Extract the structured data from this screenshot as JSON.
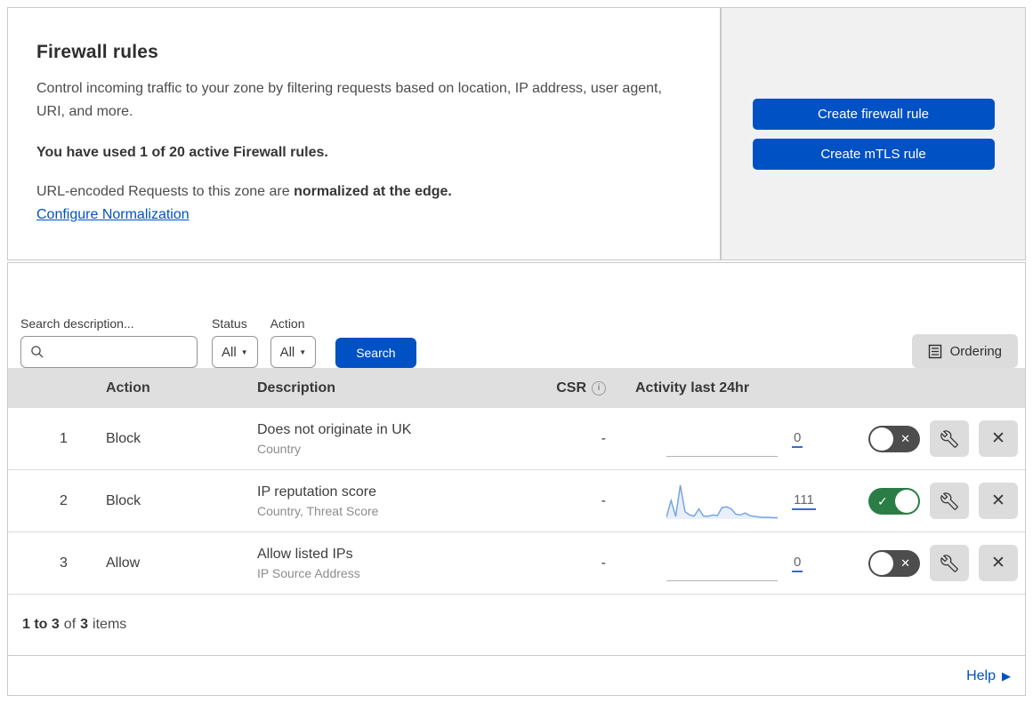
{
  "header": {
    "title": "Firewall rules",
    "description": "Control incoming traffic to your zone by filtering requests based on location, IP address, user agent, URI, and more.",
    "usage_notice": "You have used 1 of 20 active Firewall rules.",
    "normalization_text": "URL-encoded Requests to this zone are ",
    "normalization_bold": "normalized at the edge.",
    "normalization_link": "Configure Normalization"
  },
  "actions_panel": {
    "create_firewall_label": "Create firewall rule",
    "create_mtls_label": "Create mTLS rule"
  },
  "filters": {
    "search_label": "Search description...",
    "search_value": "",
    "status_label": "Status",
    "status_value": "All",
    "action_label": "Action",
    "action_value": "All",
    "search_button": "Search",
    "ordering_button": "Ordering"
  },
  "table": {
    "columns": {
      "action": "Action",
      "description": "Description",
      "csr": "CSR",
      "activity": "Activity last 24hr"
    },
    "rows": [
      {
        "index": "1",
        "action": "Block",
        "description": "Does not originate in UK",
        "criteria": "Country",
        "csr": "-",
        "count": "0",
        "enabled": false,
        "sparkline": []
      },
      {
        "index": "2",
        "action": "Block",
        "description": "IP reputation score",
        "criteria": "Country, Threat Score",
        "csr": "-",
        "count": "111",
        "enabled": true,
        "sparkline": [
          5,
          55,
          8,
          100,
          22,
          12,
          9,
          30,
          9,
          8,
          12,
          10,
          34,
          36,
          30,
          14,
          12,
          18,
          10,
          8,
          6,
          5,
          5,
          4,
          4
        ]
      },
      {
        "index": "3",
        "action": "Allow",
        "description": "Allow listed IPs",
        "criteria": "IP Source Address",
        "csr": "-",
        "count": "0",
        "enabled": false,
        "sparkline": []
      }
    ]
  },
  "footer": {
    "range": "1 to 3",
    "of_text": "of",
    "total": "3",
    "items_text": "items",
    "help_label": "Help"
  },
  "icons": {
    "dropdown_arrow": "▼",
    "help_arrow": "▶",
    "toggle_check": "✓",
    "toggle_x": "✕",
    "close_x": "✕",
    "info_i": "i"
  },
  "colors": {
    "accent_blue": "#0051c3",
    "toggle_on_green": "#2a7d45",
    "toggle_off_gray": "#4d4d4d",
    "sparkline_blue": "#76a5e2",
    "panel_gray": "#f1f1f1"
  }
}
